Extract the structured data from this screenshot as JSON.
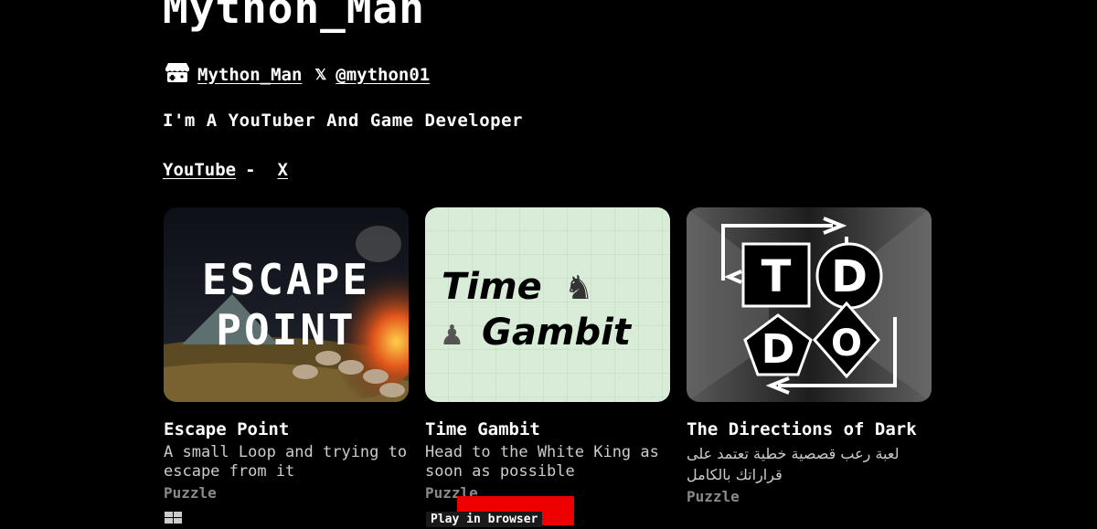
{
  "profile": {
    "title": "Mython_Man",
    "itch_name": "Mython_Man",
    "x_handle": "@mython01",
    "bio": "I'm A YouTuber And Game Developer",
    "links": {
      "youtube": "YouTube",
      "separator": "-",
      "x": "X"
    }
  },
  "games": [
    {
      "name": "Escape Point",
      "description": "A small Loop and trying to escape from it",
      "genre": "Puzzle",
      "thumb_text": [
        "ESCAPE",
        "POINT"
      ]
    },
    {
      "name": "Time Gambit",
      "description": "Head to the White King as soon as possible",
      "genre": "Puzzle",
      "thumb_text": [
        "Time",
        "Gambit"
      ]
    },
    {
      "name": "The Directions of Dark",
      "description": "لعبة رعب قصصية خطية تعتمد على قراراتك بالكامل",
      "genre": "Puzzle",
      "thumb_text": [
        "T",
        "D",
        "D",
        "O"
      ]
    }
  ],
  "badges": {
    "play_in_browser": "Play in browser"
  },
  "colors": {
    "background": "#000000",
    "text": "#ffffff",
    "genre": "#8a8a8a",
    "time_gambit_bg": "#d9ecd7",
    "red_block": "#ee0000"
  }
}
